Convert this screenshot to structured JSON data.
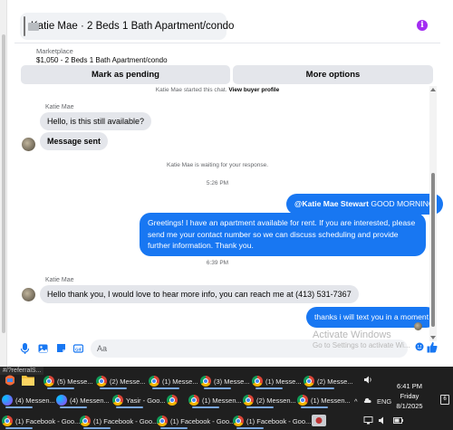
{
  "header": {
    "title": "Katie Mae · 2 Beds 1 Bath Apartment/condo",
    "marketplace_label": "Marketplace",
    "listing": "$1,050 - 2 Beds 1 Bath Apartment/condo"
  },
  "actions": {
    "mark_pending": "Mark as pending",
    "more_options": "More options"
  },
  "conversation": {
    "started_prefix": "Katie Mae started this chat.",
    "view_profile": "View buyer profile",
    "buyer_name": "Katie Mae",
    "msg1": "Hello, is this still available?",
    "msg2": "Message sent",
    "waiting": "Katie Mae is waiting for your response.",
    "time1": "5:26 PM",
    "out_mention": "@Katie Mae Stewart",
    "out_greeting": " GOOD MORNING",
    "out_long": "Greetings! I have an apartment available for rent. If you are interested, please send me your contact number so we can discuss scheduling and provide further information. Thank you.",
    "time2": "6:39 PM",
    "msg3": "Hello thank you, I would love to hear more info, you can reach me at (413) 531-7367",
    "out_last": "thanks i will text you in a moment"
  },
  "composer": {
    "placeholder": "Aa"
  },
  "watermark": {
    "line1": "Activate Windows",
    "line2": "Go to Settings to activate Wi..."
  },
  "taskbar": {
    "url_fragment": "#/?referralS...",
    "row1": [
      "(5) Messe...",
      "(2) Messe...",
      "(1) Messe...",
      "(3) Messe...",
      "(1) Messe...",
      "(2) Messe..."
    ],
    "row2": [
      "(4) Messen...",
      "(4) Messen...",
      "Yasir - Goo...",
      "",
      "(1) Messen...",
      "(2) Messen...",
      "(1) Messen..."
    ],
    "row3": [
      "(1) Facebook - Goo...",
      "(1) Facebook - Goo...",
      "(1) Facebook - Goo...",
      "(1) Facebook - Goo..."
    ],
    "lang": "ENG",
    "time": "6:41 PM",
    "day": "Friday",
    "date": "8/1/2025",
    "notifications": "6"
  },
  "colors": {
    "accent_blue": "#1877f2",
    "info_purple": "#a32cf2",
    "taskbar": "#1f1f1f"
  }
}
